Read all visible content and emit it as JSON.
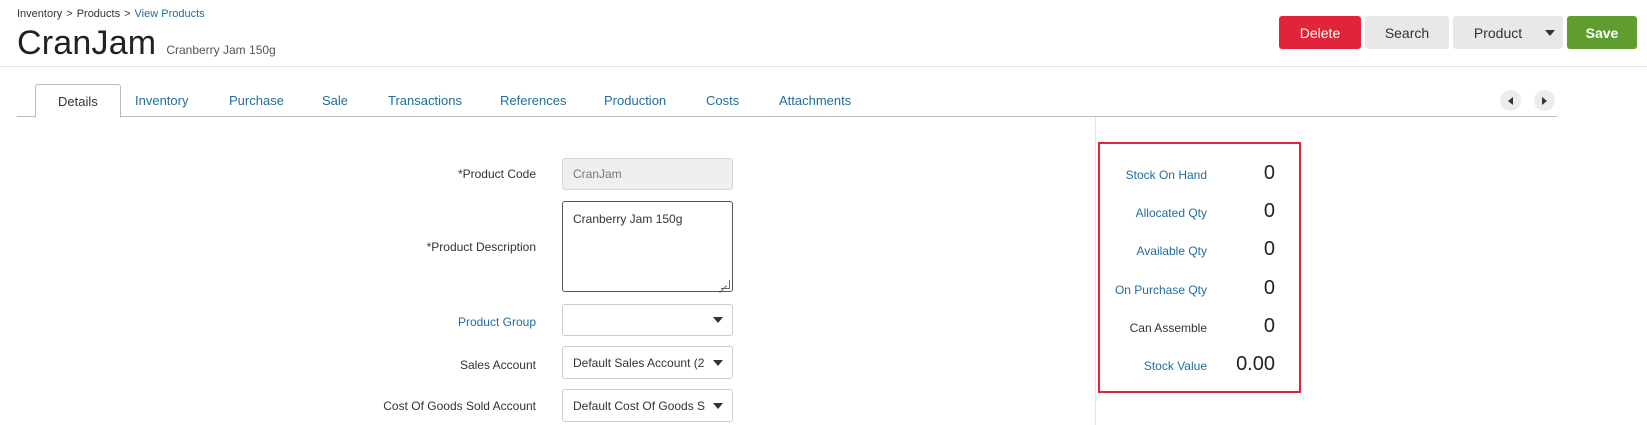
{
  "breadcrumb": {
    "items": [
      "Inventory",
      "Products"
    ],
    "current": "View Products",
    "separator": ">"
  },
  "header": {
    "title": "CranJam",
    "subtitle": "Cranberry Jam 150g"
  },
  "toolbar": {
    "delete_label": "Delete",
    "search_label": "Search",
    "product_label": "Product",
    "save_label": "Save"
  },
  "tabs": [
    {
      "label": "Details",
      "active": true
    },
    {
      "label": "Inventory"
    },
    {
      "label": "Purchase"
    },
    {
      "label": "Sale"
    },
    {
      "label": "Transactions"
    },
    {
      "label": "References"
    },
    {
      "label": "Production"
    },
    {
      "label": "Costs"
    },
    {
      "label": "Attachments"
    }
  ],
  "form": {
    "product_code": {
      "label": "*Product Code",
      "value": "CranJam"
    },
    "product_description": {
      "label": "*Product Description",
      "value": "Cranberry Jam 150g"
    },
    "product_group": {
      "label": "Product Group",
      "value": ""
    },
    "sales_account": {
      "label": "Sales Account",
      "value": "Default Sales Account (2"
    },
    "cogs_account": {
      "label": "Cost Of Goods Sold Account",
      "value": "Default Cost Of Goods S"
    }
  },
  "stats": [
    {
      "label": "Stock On Hand",
      "value": "0"
    },
    {
      "label": "Allocated Qty",
      "value": "0"
    },
    {
      "label": "Available Qty",
      "value": "0"
    },
    {
      "label": "On Purchase Qty",
      "value": "0"
    },
    {
      "label": "Can Assemble",
      "value": "0"
    },
    {
      "label": "Stock Value",
      "value": "0.00"
    }
  ],
  "colors": {
    "delete": "#e0243a",
    "save": "#5f9e2e",
    "link": "#1f6e9c",
    "highlight_border": "#e0243a"
  },
  "icons": {
    "product_dropdown": "chevron-down-icon",
    "tab_prev": "chevron-left-icon",
    "tab_next": "chevron-right-icon"
  }
}
